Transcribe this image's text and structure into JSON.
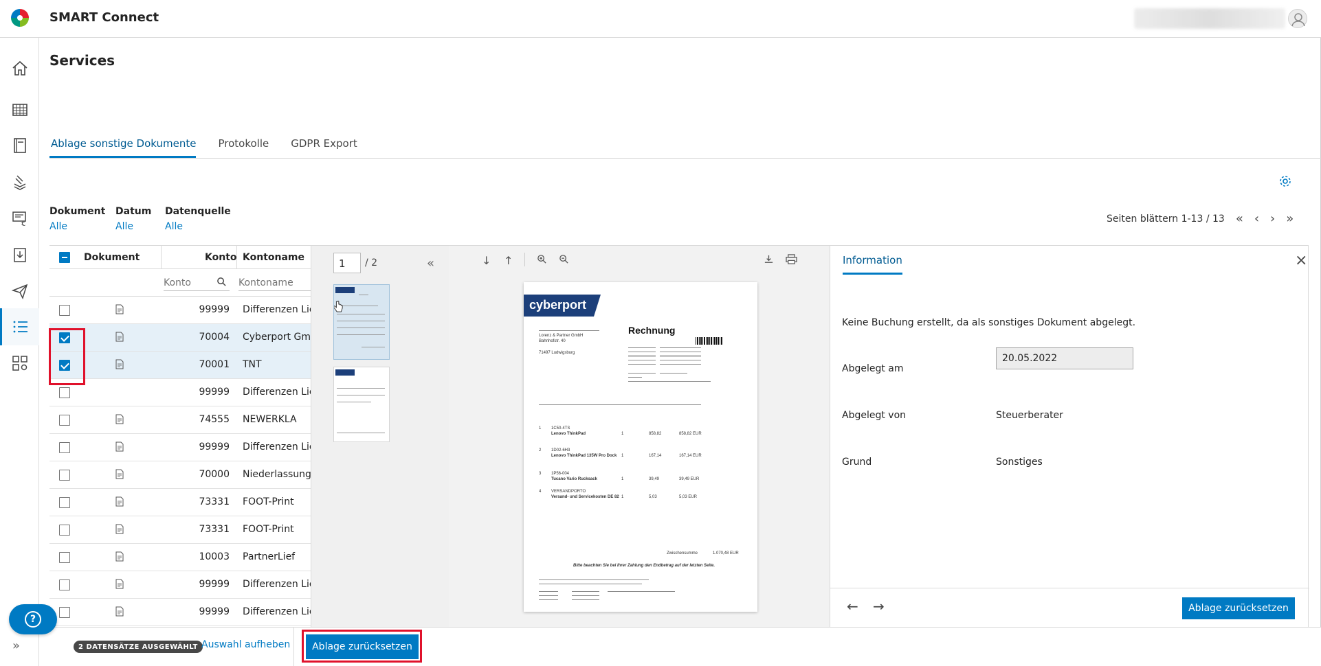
{
  "app": {
    "title": "SMART Connect"
  },
  "page": {
    "title": "Services"
  },
  "tabs": [
    {
      "label": "Ablage sonstige Dokumente",
      "active": true
    },
    {
      "label": "Protokolle",
      "active": false
    },
    {
      "label": "GDPR Export",
      "active": false
    }
  ],
  "filters": [
    {
      "label": "Dokument",
      "value": "Alle"
    },
    {
      "label": "Datum",
      "value": "Alle"
    },
    {
      "label": "Datenquelle",
      "value": "Alle"
    }
  ],
  "pager": {
    "text": "Seiten blättern 1-13 / 13"
  },
  "table": {
    "headers": {
      "dokument": "Dokument",
      "konto": "Konto",
      "kontoname": "Kontoname"
    },
    "filter_placeholders": {
      "konto": "Konto",
      "kontoname": "Kontoname"
    },
    "rows": [
      {
        "konto": "99999",
        "name": "Differenzen Lief",
        "checked": false,
        "doc": true
      },
      {
        "konto": "70004",
        "name": "Cyberport Gmbh",
        "checked": true,
        "doc": true
      },
      {
        "konto": "70001",
        "name": "TNT",
        "checked": true,
        "doc": true
      },
      {
        "konto": "99999",
        "name": "Differenzen Lief",
        "checked": false,
        "doc": false
      },
      {
        "konto": "74555",
        "name": "NEWERKLA",
        "checked": false,
        "doc": true
      },
      {
        "konto": "99999",
        "name": "Differenzen Lief",
        "checked": false,
        "doc": true
      },
      {
        "konto": "70000",
        "name": "Niederlassung I",
        "checked": false,
        "doc": true
      },
      {
        "konto": "73331",
        "name": "FOOT-Print",
        "checked": false,
        "doc": true
      },
      {
        "konto": "73331",
        "name": "FOOT-Print",
        "checked": false,
        "doc": true
      },
      {
        "konto": "10003",
        "name": "PartnerLief",
        "checked": false,
        "doc": true
      },
      {
        "konto": "99999",
        "name": "Differenzen Lief",
        "checked": false,
        "doc": true
      },
      {
        "konto": "99999",
        "name": "Differenzen Lief",
        "checked": false,
        "doc": true
      }
    ]
  },
  "viewer": {
    "page_input": "1",
    "page_total": "/ 2",
    "document": {
      "brand": "cyberport",
      "heading": "Rechnung",
      "address": [
        "Lorenz & Partner GmbH",
        "Bahnhofstr. 40",
        "71497 Ludwigsburg"
      ],
      "total_label": "Zwischensumme",
      "total_value": "1.070,48  EUR",
      "note": "Bitte beachten Sie bei Ihrer Zahlung den Endbetrag auf der letzten Seite.",
      "items": [
        {
          "pos": "1",
          "code": "1C50-4TS",
          "desc": "Lenovo ThinkPad",
          "qty": "1",
          "price": "858,82",
          "total": "858,82  EUR"
        },
        {
          "pos": "2",
          "code": "1D02-6H3",
          "desc": "Lenovo ThinkPad 135W Pro Dock",
          "qty": "1",
          "price": "167,14",
          "total": "167,14  EUR"
        },
        {
          "pos": "3",
          "code": "1P56-004",
          "desc": "Tucano Vario Rucksack",
          "qty": "1",
          "price": "39,49",
          "total": "39,49  EUR"
        },
        {
          "pos": "4",
          "code": "VERSANDPORTO",
          "desc": "Versand- und Servicekosten DE 82",
          "qty": "1",
          "price": "5,03",
          "total": "5,03  EUR"
        }
      ]
    }
  },
  "info": {
    "tab": "Information",
    "message": "Keine Buchung erstellt, da als sonstiges Dokument abgelegt.",
    "fields": {
      "abgelegt_am_label": "Abgelegt am",
      "abgelegt_am_value": "20.05.2022",
      "abgelegt_von_label": "Abgelegt von",
      "abgelegt_von_value": "Steuerberater",
      "grund_label": "Grund",
      "grund_value": "Sonstiges"
    },
    "reset_button": "Ablage zurücksetzen"
  },
  "bottom": {
    "badge": "2 DATENSÄTZE AUSGEWÄHLT",
    "clear_link": "Auswahl aufheben",
    "reset_button": "Ablage zurücksetzen"
  },
  "colors": {
    "accent": "#007ac3",
    "highlight": "#e0112b",
    "selected_row": "#e5f0f8"
  }
}
